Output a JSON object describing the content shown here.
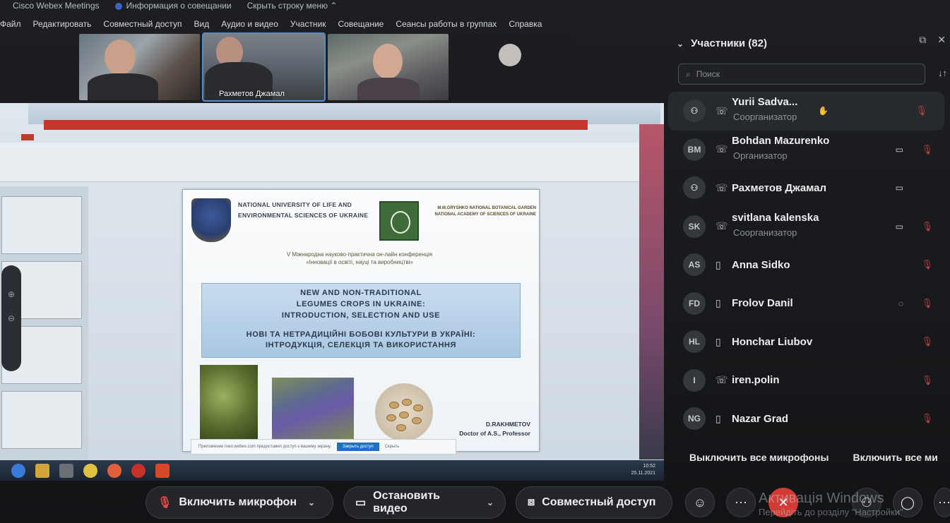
{
  "app": {
    "title": "Cisco Webex Meetings",
    "meeting_info": "Информация о совещании",
    "hide_menu": "Скрыть строку меню"
  },
  "menu": [
    "Файл",
    "Редактировать",
    "Совместный доступ",
    "Вид",
    "Аудио и видео",
    "Участник",
    "Совещание",
    "Сеансы работы в группах",
    "Справка"
  ],
  "videos": [
    {
      "name": ""
    },
    {
      "name": "Рахметов Джамал"
    },
    {
      "name": ""
    },
    {
      "name": ""
    }
  ],
  "shared_slide": {
    "university": "NATIONAL UNIVERSITY OF LIFE AND ENVIRONMENTAL SCIENCES OF UKRAINE",
    "garden": "M.M.GRYSHKO NATIONAL BOTANICAL GARDEN NATIONAL ACADEMY OF SCIENCES OF UKRAINE",
    "conference_line1": "V Міжнародна науково-практична он-лайн конференція",
    "conference_line2": "«Інновації в освіті, науці та виробництві»",
    "title_en_1": "NEW AND NON-TRADITIONAL",
    "title_en_2": "LEGUMES CROPS IN UKRAINE:",
    "title_en_3": "INTRODUCTION, SELECTION AND USE",
    "title_ua_1": "НОВІ ТА НЕТРАДИЦІЙНІ БОБОВІ КУЛЬТУРИ В УКРАЇНІ:",
    "title_ua_2": "ІНТРОДУКЦІЯ, СЕЛЕКЦІЯ ТА ВИКОРИСТАННЯ",
    "author": "D.RAKHMETOV",
    "author_title": "Doctor of A.S., Professor",
    "notice": "Приложение rueo.webex.com предоставил доступ к вашему экрану.",
    "notice_button": "Закрыть доступ",
    "notice_hide": "Скрыть",
    "time": "10:52",
    "date": "25.11.2021"
  },
  "participants": {
    "header": "Участники (82)",
    "search_placeholder": "Поиск",
    "list": [
      {
        "initials": "",
        "name": "Yurii Sadva...",
        "role": "Соорганизатор",
        "icon": "phone",
        "cam": false,
        "highlight": true
      },
      {
        "initials": "BM",
        "name": "Bohdan Mazurenko",
        "role": "Организатор",
        "icon": "phone",
        "cam": true
      },
      {
        "initials": "",
        "name": "Рахметов Джамал",
        "role": "",
        "icon": "phone",
        "cam": true
      },
      {
        "initials": "SK",
        "name": "svitlana kalenska",
        "role": "Соорганизатор",
        "icon": "phone",
        "cam": true
      },
      {
        "initials": "AS",
        "name": "Anna Sidko",
        "role": "",
        "icon": "mobile",
        "cam": false
      },
      {
        "initials": "FD",
        "name": "Frolov Danil",
        "role": "",
        "icon": "mobile",
        "cam": false
      },
      {
        "initials": "HL",
        "name": "Honchar Liubov",
        "role": "",
        "icon": "mobile",
        "cam": false
      },
      {
        "initials": "I",
        "name": "iren.polin",
        "role": "",
        "icon": "phone",
        "cam": false
      },
      {
        "initials": "NG",
        "name": "Nazar Grad",
        "role": "",
        "icon": "mobile",
        "cam": false
      }
    ],
    "mute_all": "Выключить все микрофоны",
    "unmute_all": "Включить все ми"
  },
  "controls": {
    "unmute": "Включить микрофон",
    "stop_video": "Остановить видео",
    "share": "Совместный доступ"
  },
  "watermark": {
    "line1": "Активація Windows",
    "line2": "Перейдіть до розділу \"Настройки\""
  }
}
